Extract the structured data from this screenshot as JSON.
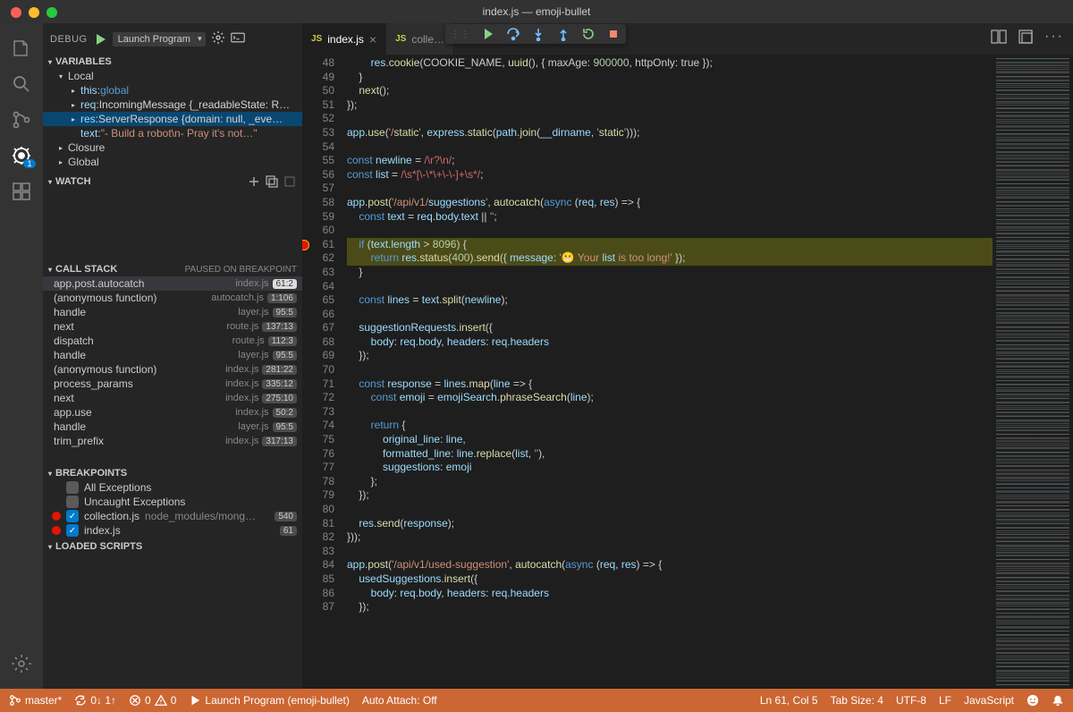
{
  "window": {
    "title": "index.js — emoji-bullet"
  },
  "activitybar": {
    "items": [
      "files",
      "search",
      "scm",
      "debug",
      "extensions"
    ],
    "debug_badge": "1"
  },
  "debug_sidebar": {
    "title": "DEBUG",
    "launch_config": "Launch Program",
    "sections": {
      "variables": {
        "label": "VARIABLES",
        "local_label": "Local",
        "entries": [
          {
            "name": "this",
            "value": "global",
            "type": "kw"
          },
          {
            "name": "req",
            "value": "IncomingMessage {_readableState: R…"
          },
          {
            "name": "res",
            "value": "ServerResponse {domain: null, _eve…",
            "selected": true
          },
          {
            "name": "text",
            "value": "\"- Build a robot\\n- Pray it's not…\"",
            "leaf": true,
            "type": "str"
          }
        ],
        "closure_label": "Closure",
        "global_label": "Global"
      },
      "watch": {
        "label": "WATCH"
      },
      "callstack": {
        "label": "CALL STACK",
        "hint": "PAUSED ON BREAKPOINT",
        "frames": [
          {
            "fn": "app.post.autocatch",
            "file": "index.js",
            "pos": "61:2",
            "selected": true
          },
          {
            "fn": "(anonymous function)",
            "file": "autocatch.js",
            "pos": "1:106"
          },
          {
            "fn": "handle",
            "file": "layer.js",
            "pos": "95:5"
          },
          {
            "fn": "next",
            "file": "route.js",
            "pos": "137:13"
          },
          {
            "fn": "dispatch",
            "file": "route.js",
            "pos": "112:3"
          },
          {
            "fn": "handle",
            "file": "layer.js",
            "pos": "95:5"
          },
          {
            "fn": "(anonymous function)",
            "file": "index.js",
            "pos": "281:22"
          },
          {
            "fn": "process_params",
            "file": "index.js",
            "pos": "335:12"
          },
          {
            "fn": "next",
            "file": "index.js",
            "pos": "275:10"
          },
          {
            "fn": "app.use",
            "file": "index.js",
            "pos": "50:2"
          },
          {
            "fn": "handle",
            "file": "layer.js",
            "pos": "95:5"
          },
          {
            "fn": "trim_prefix",
            "file": "index.js",
            "pos": "317:13"
          }
        ]
      },
      "breakpoints": {
        "label": "BREAKPOINTS",
        "all_exceptions": "All Exceptions",
        "uncaught": "Uncaught Exceptions",
        "entries": [
          {
            "file": "collection.js",
            "path": "node_modules/mong…",
            "num": "540",
            "checked": true
          },
          {
            "file": "index.js",
            "path": "",
            "num": "61",
            "checked": true
          }
        ]
      },
      "loaded_scripts": {
        "label": "LOADED SCRIPTS"
      }
    }
  },
  "tabs": [
    {
      "name": "index.js",
      "active": true
    },
    {
      "name": "colle…",
      "active": false
    }
  ],
  "code": {
    "first_line": 48,
    "breakpoint_line": 61,
    "lines": [
      "        res.cookie(COOKIE_NAME, uuid(), { maxAge: 900000, httpOnly: true });",
      "    }",
      "    next();",
      "});",
      "",
      "app.use('/static', express.static(path.join(__dirname, 'static')));",
      "",
      "const newline = /\\r?\\n/;",
      "const list = /\\s*[\\-\\*\\+\\-\\-]+\\s*/;",
      "",
      "app.post('/api/v1/suggestions', autocatch(async (req, res) => {",
      "    const text = req.body.text || '';",
      "",
      "    if (text.length > 8096) {",
      "        return res.status(400).send({ message: '😬 Your list is too long!' });",
      "    }",
      "",
      "    const lines = text.split(newline);",
      "",
      "    suggestionRequests.insert({",
      "        body: req.body, headers: req.headers",
      "    });",
      "",
      "    const response = lines.map(line => {",
      "        const emoji = emojiSearch.phraseSearch(line);",
      "",
      "        return {",
      "            original_line: line,",
      "            formatted_line: line.replace(list, ''),",
      "            suggestions: emoji",
      "        };",
      "    });",
      "",
      "    res.send(response);",
      "}));",
      "",
      "app.post('/api/v1/used-suggestion', autocatch(async (req, res) => {",
      "    usedSuggestions.insert({",
      "        body: req.body, headers: req.headers",
      "    });"
    ]
  },
  "status": {
    "branch": "master*",
    "sync": "0↓ 1↑",
    "errors": "0",
    "warnings": "0",
    "launch": "Launch Program (emoji-bullet)",
    "auto_attach": "Auto Attach: Off",
    "cursor": "Ln 61, Col 5",
    "tabsize": "Tab Size: 4",
    "encoding": "UTF-8",
    "eol": "LF",
    "lang": "JavaScript"
  }
}
